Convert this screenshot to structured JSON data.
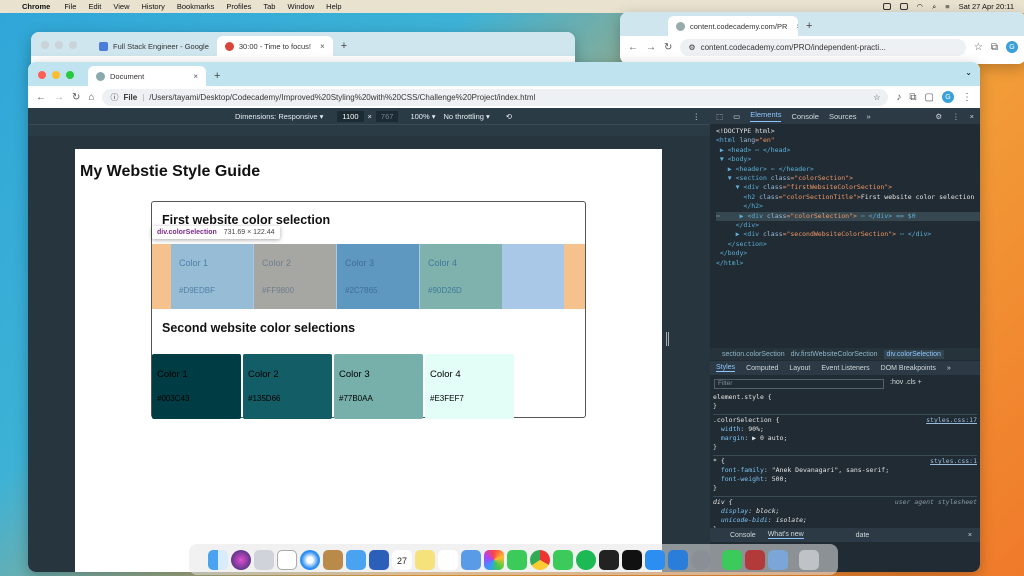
{
  "menubar": {
    "apple": "",
    "app": "Chrome",
    "items": [
      "File",
      "Edit",
      "View",
      "History",
      "Bookmarks",
      "Profiles",
      "Tab",
      "Window",
      "Help"
    ],
    "clock": "Sat 27 Apr 20:11"
  },
  "back_window": {
    "tabs": [
      {
        "title": "Full Stack Engineer - Google",
        "favicon_color": "#4a7ed8"
      },
      {
        "title": "30:00 - Time to focus!",
        "favicon_color": "#d9453a"
      }
    ],
    "add": "+"
  },
  "right_window": {
    "tab": "content.codecademy.com/PR",
    "url": "content.codecademy.com/PRO/independent-practi...",
    "add": "+",
    "profile": "G"
  },
  "main": {
    "tab_title": "Document",
    "tab_close": "×",
    "add": "+",
    "url_prefix": "File",
    "url": "/Users/tayami/Desktop/Codecademy/Improved%20Styling%20with%20CSS/Challenge%20Project/index.html",
    "profile": "G",
    "devbar": {
      "dimensions": "Dimensions: Responsive ▾",
      "width": "1100",
      "times": "×",
      "height": "767",
      "zoom": "100% ▾",
      "throttle": "No throttling ▾"
    },
    "page": {
      "title": "My Webstie Style Guide",
      "section1_title": "First website color selection",
      "section2_title": "Second website color selections",
      "tooltip_selector": "div.colorSelection",
      "tooltip_dims": "731.69 × 122.44",
      "colors1": [
        {
          "name": "Color 1",
          "hex": "#D9EDBF",
          "bg": "#97bdd6",
          "fg": "#4f7fa6"
        },
        {
          "name": "Color 2",
          "hex": "#FF9800",
          "bg": "#a6a6a3",
          "fg": "#6f7e8c"
        },
        {
          "name": "Color 3",
          "hex": "#2C7865",
          "bg": "#5e97bf",
          "fg": "#3d6f99"
        },
        {
          "name": "Color 4",
          "hex": "#90D26D",
          "bg": "#7fb2ad",
          "fg": "#3d7a9a"
        }
      ],
      "colors2": [
        {
          "name": "Color 1",
          "hex": "#003C43",
          "bg": "#003c43",
          "fg": "#111111"
        },
        {
          "name": "Color 2",
          "hex": "#135D66",
          "bg": "#135d66",
          "fg": "#111111"
        },
        {
          "name": "Color 3",
          "hex": "#77B0AA",
          "bg": "#77b0aa",
          "fg": "#111111"
        },
        {
          "name": "Color 4",
          "hex": "#E3FEF7",
          "bg": "#e3fef7",
          "fg": "#111111"
        }
      ]
    },
    "devtools": {
      "tabs": [
        "Elements",
        "Console",
        "Sources",
        "»"
      ],
      "dom": {
        "l1": "<!DOCTYPE html>",
        "l2a": "<html ",
        "l2b": "lang",
        "l2c": "=\"en\"",
        "l3": "▶ <head> ⋯ </head>",
        "l4": "▼ <body>",
        "l5": "▶ <header> ⋯ </header>",
        "l6a": "▼ <section ",
        "l6b": "class",
        "l6c": "=\"colorSection\">",
        "l7a": "▼ <div ",
        "l7b": "class",
        "l7c": "=\"firstWebsiteColorSection\">",
        "l8a": "<h2 ",
        "l8b": "class",
        "l8c": "=\"colorSectionTitle\">",
        "l8d": "First website color selection",
        "l9": "</h2>",
        "l10prefix": "⋯",
        "l10a": "▶ <div ",
        "l10b": "class",
        "l10c": "=\"colorSelection\">",
        "l10d": " ⋯ </div> == $0",
        "l11": "</div>",
        "l12a": "▶ <div ",
        "l12b": "class",
        "l12c": "=\"secondWebsiteColorSection\">",
        "l12d": " ⋯ </div>",
        "l13": "</section>",
        "l14": "</body>",
        "l15": "</html>"
      },
      "crumbs": [
        "section.colorSection",
        "div.firstWebsiteColorSection",
        "div.colorSelection"
      ],
      "styles_tabs": [
        "Styles",
        "Computed",
        "Layout",
        "Event Listeners",
        "DOM Breakpoints",
        "»"
      ],
      "filter_placeholder": "Filter",
      "filter_buttons": ":hov .cls +",
      "rules": {
        "r1sel": "element.style {",
        "r1end": "}",
        "r2sel": ".colorSelection {",
        "r2src": "styles.css:17",
        "r2p1": "width",
        "r2v1": "90%;",
        "r2p2": "margin",
        "r2v2": "▶ 0 auto;",
        "r2end": "}",
        "r3sel": "* {",
        "r3src": "styles.css:1",
        "r3p1": "font-family",
        "r3v1": "\"Anek Devanagari\", sans-serif;",
        "r3p2": "font-weight",
        "r3v2": "500;",
        "r3end": "}",
        "r4sel": "div {",
        "r4src": "user agent stylesheet",
        "r4p1": "display",
        "r4v1": "block;",
        "r4p2": "unicode-bidi",
        "r4v2": "isolate;",
        "r4end": "}"
      },
      "drawer": [
        "Console",
        "What's new",
        "×"
      ],
      "drawer_text": "date"
    }
  },
  "dock": {
    "calendar_date": "27"
  },
  "colors": {
    "chrome_tab": "#c5e3ee",
    "devtools_bg": "#202b33",
    "accent": "#8ec5ff"
  }
}
